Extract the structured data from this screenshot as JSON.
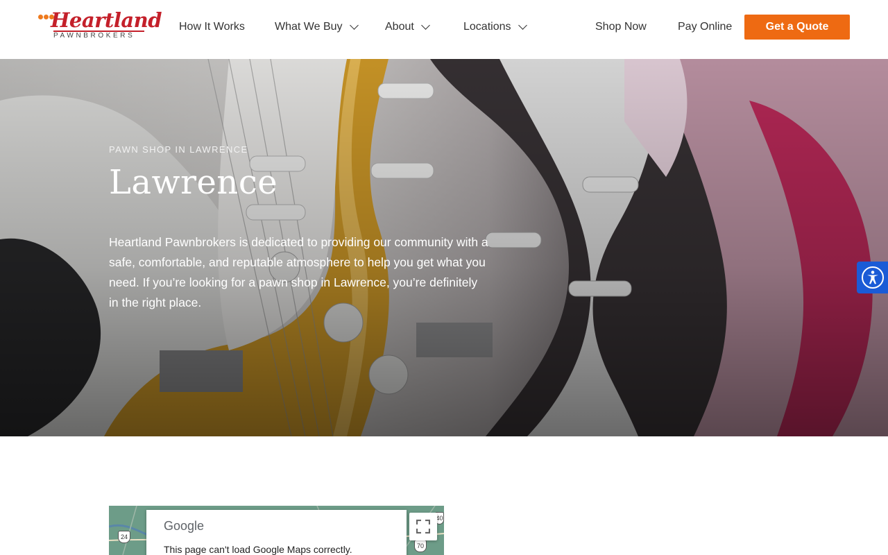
{
  "header": {
    "logo": {
      "wordmark": "Heartland",
      "subtitle": "PAWNBROKERS",
      "icon": "logo-dots",
      "brand_color": "#c4202a",
      "accent_color": "#ee7a1e"
    },
    "nav": [
      {
        "label": "How It Works",
        "has_dropdown": false
      },
      {
        "label": "What We Buy",
        "has_dropdown": true
      },
      {
        "label": "About",
        "has_dropdown": true
      },
      {
        "label": "Locations",
        "has_dropdown": true
      }
    ],
    "shop_now": "Shop Now",
    "pay_online": "Pay Online",
    "cta": {
      "label": "Get a Quote",
      "color": "#ee6a12"
    }
  },
  "hero": {
    "eyebrow": "PAWN SHOP IN LAWRENCE",
    "title": "Lawrence",
    "body": "Heartland Pawnbrokers is dedicated to providing our community with a safe, comfortable, and reputable atmosphere to help you get what you need. If you’re looking for a pawn shop in Lawrence, you’re definitely in the right place."
  },
  "accessibility": {
    "icon": "accessibility-icon",
    "color": "#1a5bd6"
  },
  "map": {
    "provider": "Google",
    "error": "This page can't load Google Maps correctly.",
    "route_labels": [
      "24",
      "70",
      "40"
    ],
    "fullscreen_icon": "fullscreen-icon"
  }
}
